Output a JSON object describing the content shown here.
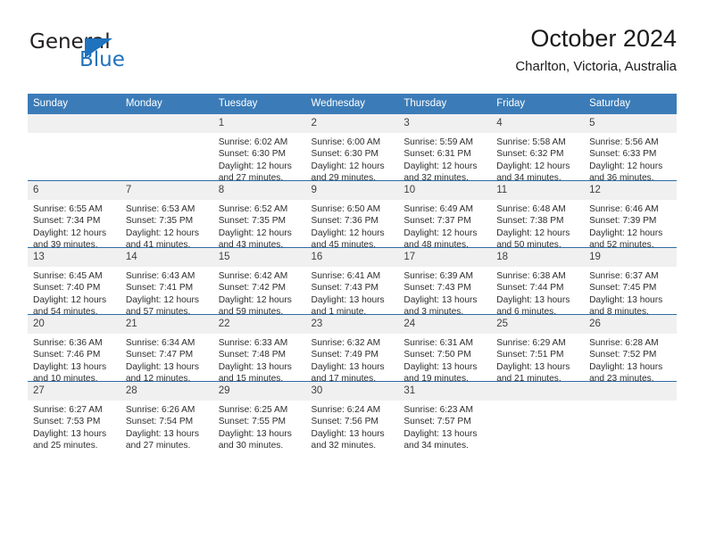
{
  "brand": {
    "word1": "General",
    "word2": "Blue",
    "logo_icon": "triangle-logo-icon",
    "accent_color": "#1f72bd"
  },
  "header": {
    "title": "October 2024",
    "location": "Charlton, Victoria, Australia"
  },
  "theme": {
    "header_blue": "#3b7cb8",
    "row_divider_blue": "#2e6da4",
    "daynum_band": "#f0f0f0",
    "text": "#2e2e2e"
  },
  "weekday_headers": [
    "Sunday",
    "Monday",
    "Tuesday",
    "Wednesday",
    "Thursday",
    "Friday",
    "Saturday"
  ],
  "labels": {
    "sunrise_prefix": "Sunrise:",
    "sunset_prefix": "Sunset:",
    "daylight_prefix": "Daylight:"
  },
  "weeks": [
    [
      {
        "day": "",
        "sunrise": "",
        "sunset": "",
        "daylight": ""
      },
      {
        "day": "",
        "sunrise": "",
        "sunset": "",
        "daylight": ""
      },
      {
        "day": "1",
        "sunrise": "Sunrise: 6:02 AM",
        "sunset": "Sunset: 6:30 PM",
        "daylight": "Daylight: 12 hours and 27 minutes."
      },
      {
        "day": "2",
        "sunrise": "Sunrise: 6:00 AM",
        "sunset": "Sunset: 6:30 PM",
        "daylight": "Daylight: 12 hours and 29 minutes."
      },
      {
        "day": "3",
        "sunrise": "Sunrise: 5:59 AM",
        "sunset": "Sunset: 6:31 PM",
        "daylight": "Daylight: 12 hours and 32 minutes."
      },
      {
        "day": "4",
        "sunrise": "Sunrise: 5:58 AM",
        "sunset": "Sunset: 6:32 PM",
        "daylight": "Daylight: 12 hours and 34 minutes."
      },
      {
        "day": "5",
        "sunrise": "Sunrise: 5:56 AM",
        "sunset": "Sunset: 6:33 PM",
        "daylight": "Daylight: 12 hours and 36 minutes."
      }
    ],
    [
      {
        "day": "6",
        "sunrise": "Sunrise: 6:55 AM",
        "sunset": "Sunset: 7:34 PM",
        "daylight": "Daylight: 12 hours and 39 minutes."
      },
      {
        "day": "7",
        "sunrise": "Sunrise: 6:53 AM",
        "sunset": "Sunset: 7:35 PM",
        "daylight": "Daylight: 12 hours and 41 minutes."
      },
      {
        "day": "8",
        "sunrise": "Sunrise: 6:52 AM",
        "sunset": "Sunset: 7:35 PM",
        "daylight": "Daylight: 12 hours and 43 minutes."
      },
      {
        "day": "9",
        "sunrise": "Sunrise: 6:50 AM",
        "sunset": "Sunset: 7:36 PM",
        "daylight": "Daylight: 12 hours and 45 minutes."
      },
      {
        "day": "10",
        "sunrise": "Sunrise: 6:49 AM",
        "sunset": "Sunset: 7:37 PM",
        "daylight": "Daylight: 12 hours and 48 minutes."
      },
      {
        "day": "11",
        "sunrise": "Sunrise: 6:48 AM",
        "sunset": "Sunset: 7:38 PM",
        "daylight": "Daylight: 12 hours and 50 minutes."
      },
      {
        "day": "12",
        "sunrise": "Sunrise: 6:46 AM",
        "sunset": "Sunset: 7:39 PM",
        "daylight": "Daylight: 12 hours and 52 minutes."
      }
    ],
    [
      {
        "day": "13",
        "sunrise": "Sunrise: 6:45 AM",
        "sunset": "Sunset: 7:40 PM",
        "daylight": "Daylight: 12 hours and 54 minutes."
      },
      {
        "day": "14",
        "sunrise": "Sunrise: 6:43 AM",
        "sunset": "Sunset: 7:41 PM",
        "daylight": "Daylight: 12 hours and 57 minutes."
      },
      {
        "day": "15",
        "sunrise": "Sunrise: 6:42 AM",
        "sunset": "Sunset: 7:42 PM",
        "daylight": "Daylight: 12 hours and 59 minutes."
      },
      {
        "day": "16",
        "sunrise": "Sunrise: 6:41 AM",
        "sunset": "Sunset: 7:43 PM",
        "daylight": "Daylight: 13 hours and 1 minute."
      },
      {
        "day": "17",
        "sunrise": "Sunrise: 6:39 AM",
        "sunset": "Sunset: 7:43 PM",
        "daylight": "Daylight: 13 hours and 3 minutes."
      },
      {
        "day": "18",
        "sunrise": "Sunrise: 6:38 AM",
        "sunset": "Sunset: 7:44 PM",
        "daylight": "Daylight: 13 hours and 6 minutes."
      },
      {
        "day": "19",
        "sunrise": "Sunrise: 6:37 AM",
        "sunset": "Sunset: 7:45 PM",
        "daylight": "Daylight: 13 hours and 8 minutes."
      }
    ],
    [
      {
        "day": "20",
        "sunrise": "Sunrise: 6:36 AM",
        "sunset": "Sunset: 7:46 PM",
        "daylight": "Daylight: 13 hours and 10 minutes."
      },
      {
        "day": "21",
        "sunrise": "Sunrise: 6:34 AM",
        "sunset": "Sunset: 7:47 PM",
        "daylight": "Daylight: 13 hours and 12 minutes."
      },
      {
        "day": "22",
        "sunrise": "Sunrise: 6:33 AM",
        "sunset": "Sunset: 7:48 PM",
        "daylight": "Daylight: 13 hours and 15 minutes."
      },
      {
        "day": "23",
        "sunrise": "Sunrise: 6:32 AM",
        "sunset": "Sunset: 7:49 PM",
        "daylight": "Daylight: 13 hours and 17 minutes."
      },
      {
        "day": "24",
        "sunrise": "Sunrise: 6:31 AM",
        "sunset": "Sunset: 7:50 PM",
        "daylight": "Daylight: 13 hours and 19 minutes."
      },
      {
        "day": "25",
        "sunrise": "Sunrise: 6:29 AM",
        "sunset": "Sunset: 7:51 PM",
        "daylight": "Daylight: 13 hours and 21 minutes."
      },
      {
        "day": "26",
        "sunrise": "Sunrise: 6:28 AM",
        "sunset": "Sunset: 7:52 PM",
        "daylight": "Daylight: 13 hours and 23 minutes."
      }
    ],
    [
      {
        "day": "27",
        "sunrise": "Sunrise: 6:27 AM",
        "sunset": "Sunset: 7:53 PM",
        "daylight": "Daylight: 13 hours and 25 minutes."
      },
      {
        "day": "28",
        "sunrise": "Sunrise: 6:26 AM",
        "sunset": "Sunset: 7:54 PM",
        "daylight": "Daylight: 13 hours and 27 minutes."
      },
      {
        "day": "29",
        "sunrise": "Sunrise: 6:25 AM",
        "sunset": "Sunset: 7:55 PM",
        "daylight": "Daylight: 13 hours and 30 minutes."
      },
      {
        "day": "30",
        "sunrise": "Sunrise: 6:24 AM",
        "sunset": "Sunset: 7:56 PM",
        "daylight": "Daylight: 13 hours and 32 minutes."
      },
      {
        "day": "31",
        "sunrise": "Sunrise: 6:23 AM",
        "sunset": "Sunset: 7:57 PM",
        "daylight": "Daylight: 13 hours and 34 minutes."
      },
      {
        "day": "",
        "sunrise": "",
        "sunset": "",
        "daylight": ""
      },
      {
        "day": "",
        "sunrise": "",
        "sunset": "",
        "daylight": ""
      }
    ]
  ]
}
